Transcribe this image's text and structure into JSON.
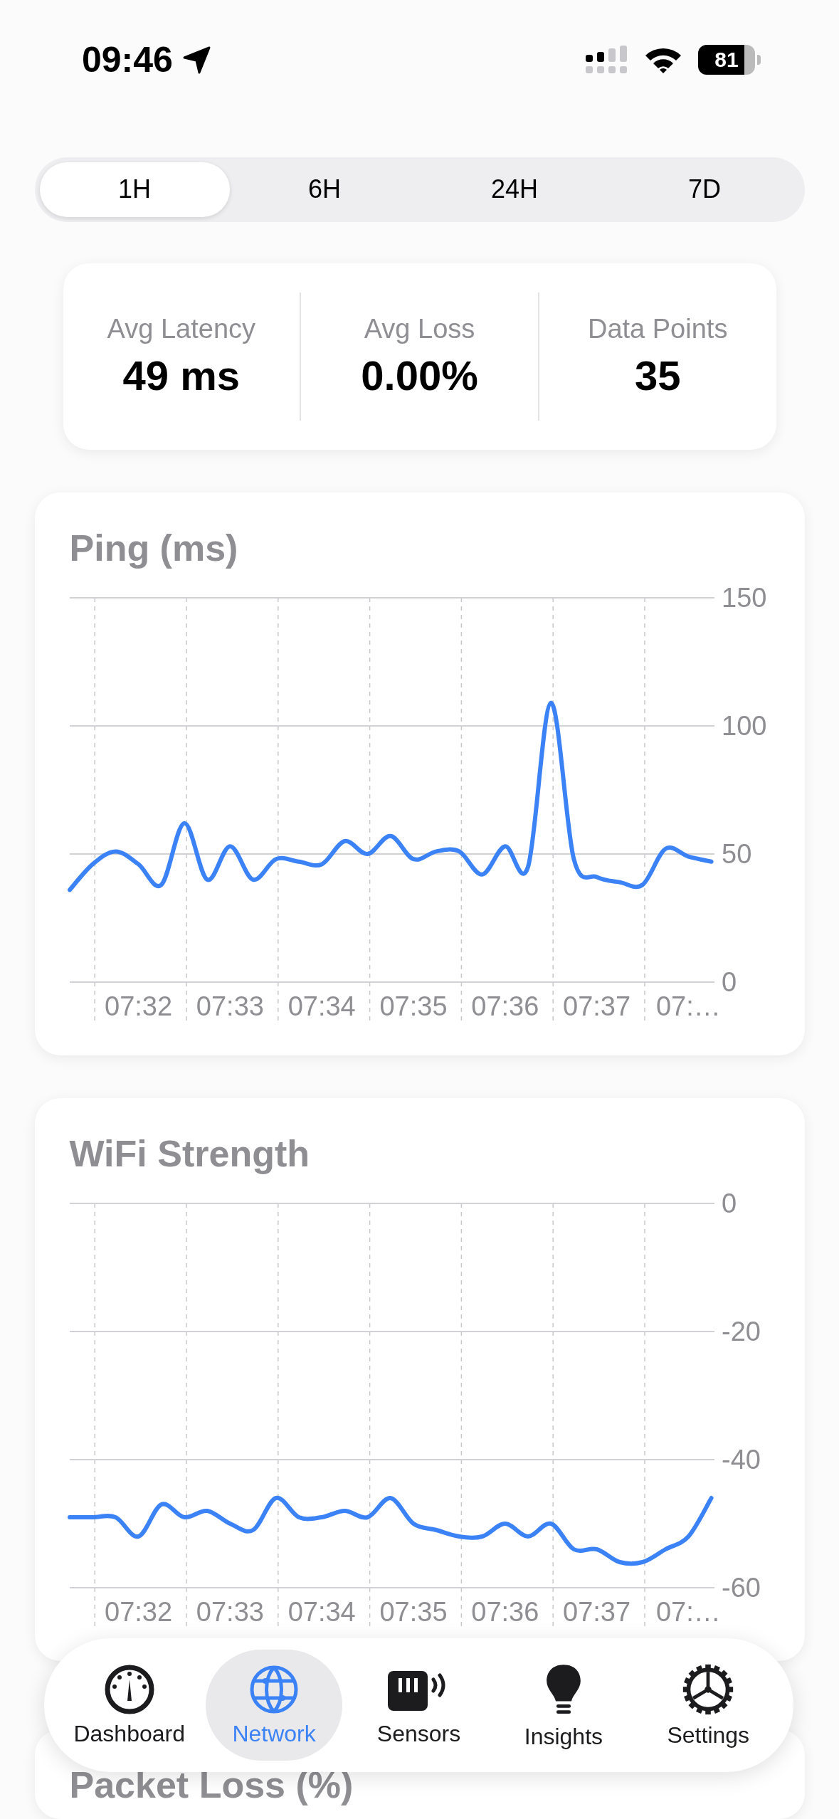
{
  "status_bar": {
    "time": "09:46",
    "battery": "81"
  },
  "range_tabs": [
    {
      "label": "1H",
      "selected": true
    },
    {
      "label": "6H",
      "selected": false
    },
    {
      "label": "24H",
      "selected": false
    },
    {
      "label": "7D",
      "selected": false
    }
  ],
  "stats": [
    {
      "label": "Avg Latency",
      "value": "49 ms"
    },
    {
      "label": "Avg Loss",
      "value": "0.00%"
    },
    {
      "label": "Data Points",
      "value": "35"
    }
  ],
  "charts": [
    {
      "title": "Ping (ms)",
      "chart_data": {
        "type": "line",
        "categories": [
          null,
          null,
          null,
          "07:32",
          null,
          null,
          null,
          "07:33",
          null,
          null,
          null,
          "07:34",
          null,
          null,
          null,
          "07:35",
          null,
          null,
          null,
          "07:36",
          null,
          null,
          null,
          "07:37",
          null,
          null,
          null,
          "07:…",
          null
        ],
        "series": [
          {
            "color": "#3b82f6",
            "values": [
              36,
              46,
              51,
              46,
              38,
              62,
              40,
              53,
              40,
              48,
              47,
              46,
              55,
              50,
              57,
              48,
              51,
              51,
              42,
              53,
              45,
              109,
              48,
              41,
              39,
              38,
              52,
              49,
              47
            ]
          }
        ],
        "ylim": [
          0,
          150
        ],
        "yticks": [
          0,
          50,
          100,
          150
        ],
        "grid": true
      }
    },
    {
      "title": "WiFi Strength",
      "chart_data": {
        "type": "line",
        "categories": [
          null,
          null,
          null,
          "07:32",
          null,
          null,
          null,
          "07:33",
          null,
          null,
          null,
          "07:34",
          null,
          null,
          null,
          "07:35",
          null,
          null,
          null,
          "07:36",
          null,
          null,
          null,
          "07:37",
          null,
          null,
          null,
          "07:…",
          null
        ],
        "series": [
          {
            "color": "#3b82f6",
            "values": [
              -49,
              -49,
              -49,
              -52,
              -47,
              -49,
              -48,
              -50,
              -51,
              -46,
              -49,
              -49,
              -48,
              -49,
              -46,
              -50,
              -51,
              -52,
              -52,
              -50,
              -52,
              -50,
              -54,
              -54,
              -56,
              -56,
              -54,
              -52,
              -46
            ]
          }
        ],
        "ylim": [
          -60,
          0
        ],
        "yticks": [
          -60,
          -40,
          -20,
          0
        ],
        "grid": true
      }
    },
    {
      "title": "Packet Loss (%)"
    }
  ],
  "tab_bar": [
    {
      "label": "Dashboard",
      "selected": false
    },
    {
      "label": "Network",
      "selected": true
    },
    {
      "label": "Sensors",
      "selected": false
    },
    {
      "label": "Insights",
      "selected": false
    },
    {
      "label": "Settings",
      "selected": false
    }
  ]
}
